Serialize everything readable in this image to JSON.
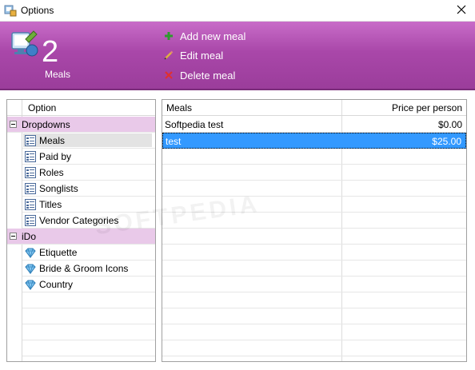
{
  "window": {
    "title": "Options",
    "close_label": "✕"
  },
  "header": {
    "count": "2",
    "count_label": "Meals",
    "actions": [
      {
        "label": "Add new meal",
        "icon": "plus-icon",
        "color": "#2e9b2e"
      },
      {
        "label": "Edit meal",
        "icon": "pencil-icon",
        "color": "#e0b040"
      },
      {
        "label": "Delete meal",
        "icon": "x-icon",
        "color": "#e03030"
      }
    ],
    "accent": "#a947a9"
  },
  "tree": {
    "header": "Option",
    "groups": [
      {
        "label": "Dropdowns",
        "items": [
          "Meals",
          "Paid by",
          "Roles",
          "Songlists",
          "Titles",
          "Vendor Categories"
        ]
      },
      {
        "label": "iDo",
        "items": [
          "Etiquette",
          "Bride & Groom Icons",
          "Country"
        ]
      }
    ],
    "selected": "Meals"
  },
  "grid": {
    "columns": [
      "Meals",
      "Price per person"
    ],
    "rows": [
      {
        "name": "Softpedia test",
        "price": "$0.00"
      },
      {
        "name": "test",
        "price": "$25.00",
        "selected": true
      }
    ],
    "selection_color": "#3399ff"
  },
  "watermark": "SOFTPEDIA"
}
